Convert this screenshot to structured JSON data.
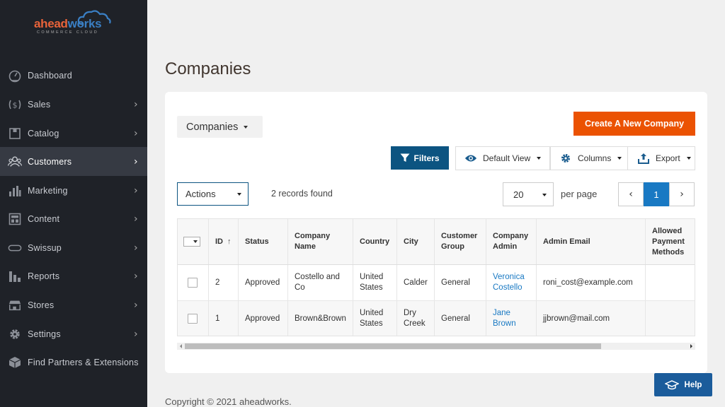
{
  "brand": {
    "name_part1": "ahead",
    "name_part2": "works",
    "tagline": "COMMERCE CLOUD",
    "cloud_icon": "cloud-icon"
  },
  "sidebar": {
    "items": [
      {
        "label": "Dashboard",
        "icon": "dashboard-icon",
        "has_children": false,
        "active": false
      },
      {
        "label": "Sales",
        "icon": "dollar-icon",
        "has_children": true,
        "active": false
      },
      {
        "label": "Catalog",
        "icon": "box-icon",
        "has_children": true,
        "active": false
      },
      {
        "label": "Customers",
        "icon": "users-icon",
        "has_children": true,
        "active": true
      },
      {
        "label": "Marketing",
        "icon": "bar-chart-icon",
        "has_children": true,
        "active": false
      },
      {
        "label": "Content",
        "icon": "layout-icon",
        "has_children": true,
        "active": false
      },
      {
        "label": "Swissup",
        "icon": "swissup-icon",
        "has_children": true,
        "active": false
      },
      {
        "label": "Reports",
        "icon": "reports-icon",
        "has_children": true,
        "active": false
      },
      {
        "label": "Stores",
        "icon": "store-icon",
        "has_children": true,
        "active": false
      },
      {
        "label": "Settings",
        "icon": "gear-icon",
        "has_children": true,
        "active": false
      },
      {
        "label": "Find Partners & Extensions",
        "icon": "extensions-icon",
        "has_children": false,
        "active": false
      }
    ]
  },
  "page": {
    "title": "Companies"
  },
  "toolbar": {
    "switcher_label": "Companies",
    "create_label": "Create A New Company",
    "filters_label": "Filters",
    "view_label": "Default View",
    "columns_label": "Columns",
    "export_label": "Export",
    "actions_label": "Actions",
    "records_text": "2 records found",
    "per_page_value": "20",
    "per_page_label": "per page",
    "current_page": "1"
  },
  "table": {
    "headers": [
      "ID",
      "Status",
      "Company Name",
      "Country",
      "City",
      "Customer Group",
      "Company Admin",
      "Admin Email",
      "Allowed Payment Methods"
    ],
    "sort_indicator": "↑",
    "rows": [
      {
        "id": "2",
        "status": "Approved",
        "company_name": "Costello and Co",
        "country": "United States",
        "city": "Calder",
        "group": "General",
        "admin": "Veronica Costello",
        "email": "roni_cost@example.com",
        "payment": ""
      },
      {
        "id": "1",
        "status": "Approved",
        "company_name": "Brown&Brown",
        "country": "United States",
        "city": "Dry Creek",
        "group": "General",
        "admin": "Jane Brown",
        "email": "jjbrown@mail.com",
        "payment": ""
      }
    ]
  },
  "footer": {
    "copyright": "Copyright © 2021 aheadworks."
  },
  "help": {
    "label": "Help"
  },
  "colors": {
    "sidebar_bg": "#1f2228",
    "accent_orange": "#eb5202",
    "primary_blue": "#0c5481",
    "link_blue": "#1979c3"
  }
}
